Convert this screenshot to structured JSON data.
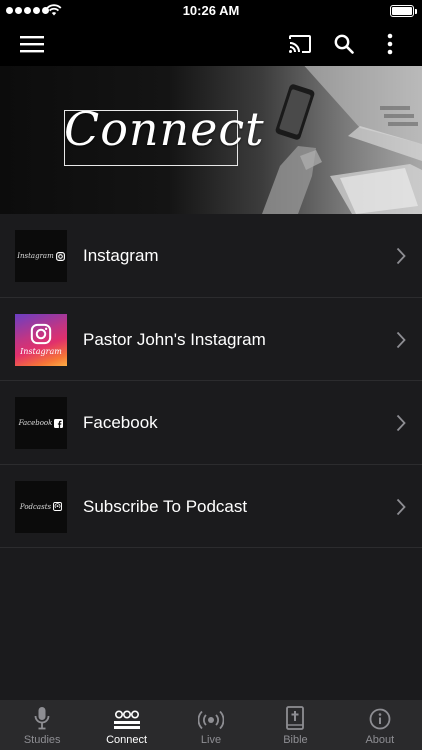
{
  "status_bar": {
    "time": "10:26 AM"
  },
  "header": {
    "menu_icon": "hamburger-menu-icon",
    "cast_icon": "cast-icon",
    "search_icon": "search-icon",
    "more_icon": "more-vertical-icon"
  },
  "hero": {
    "title": "Connect"
  },
  "list": {
    "items": [
      {
        "label": "Instagram",
        "thumb_text": "Instagram",
        "thumb_icon": "instagram-icon"
      },
      {
        "label": "Pastor John's Instagram",
        "thumb_text": "Instagram",
        "thumb_icon": "instagram-logo-icon"
      },
      {
        "label": "Facebook",
        "thumb_text": "Facebook",
        "thumb_icon": "facebook-icon"
      },
      {
        "label": "Subscribe To Podcast",
        "thumb_text": "Podcasts",
        "thumb_icon": "podcast-icon"
      }
    ]
  },
  "tabs": [
    {
      "label": "Studies",
      "icon": "microphone-icon"
    },
    {
      "label": "Connect",
      "icon": "group-icon",
      "active": true
    },
    {
      "label": "Live",
      "icon": "broadcast-icon"
    },
    {
      "label": "Bible",
      "icon": "bible-icon"
    },
    {
      "label": "About",
      "icon": "info-icon"
    }
  ],
  "colors": {
    "background": "#1b1b1d",
    "header": "#000000",
    "tab_bar": "#2a2a2c",
    "tab_inactive": "#8e8e93",
    "tab_active": "#ffffff"
  }
}
